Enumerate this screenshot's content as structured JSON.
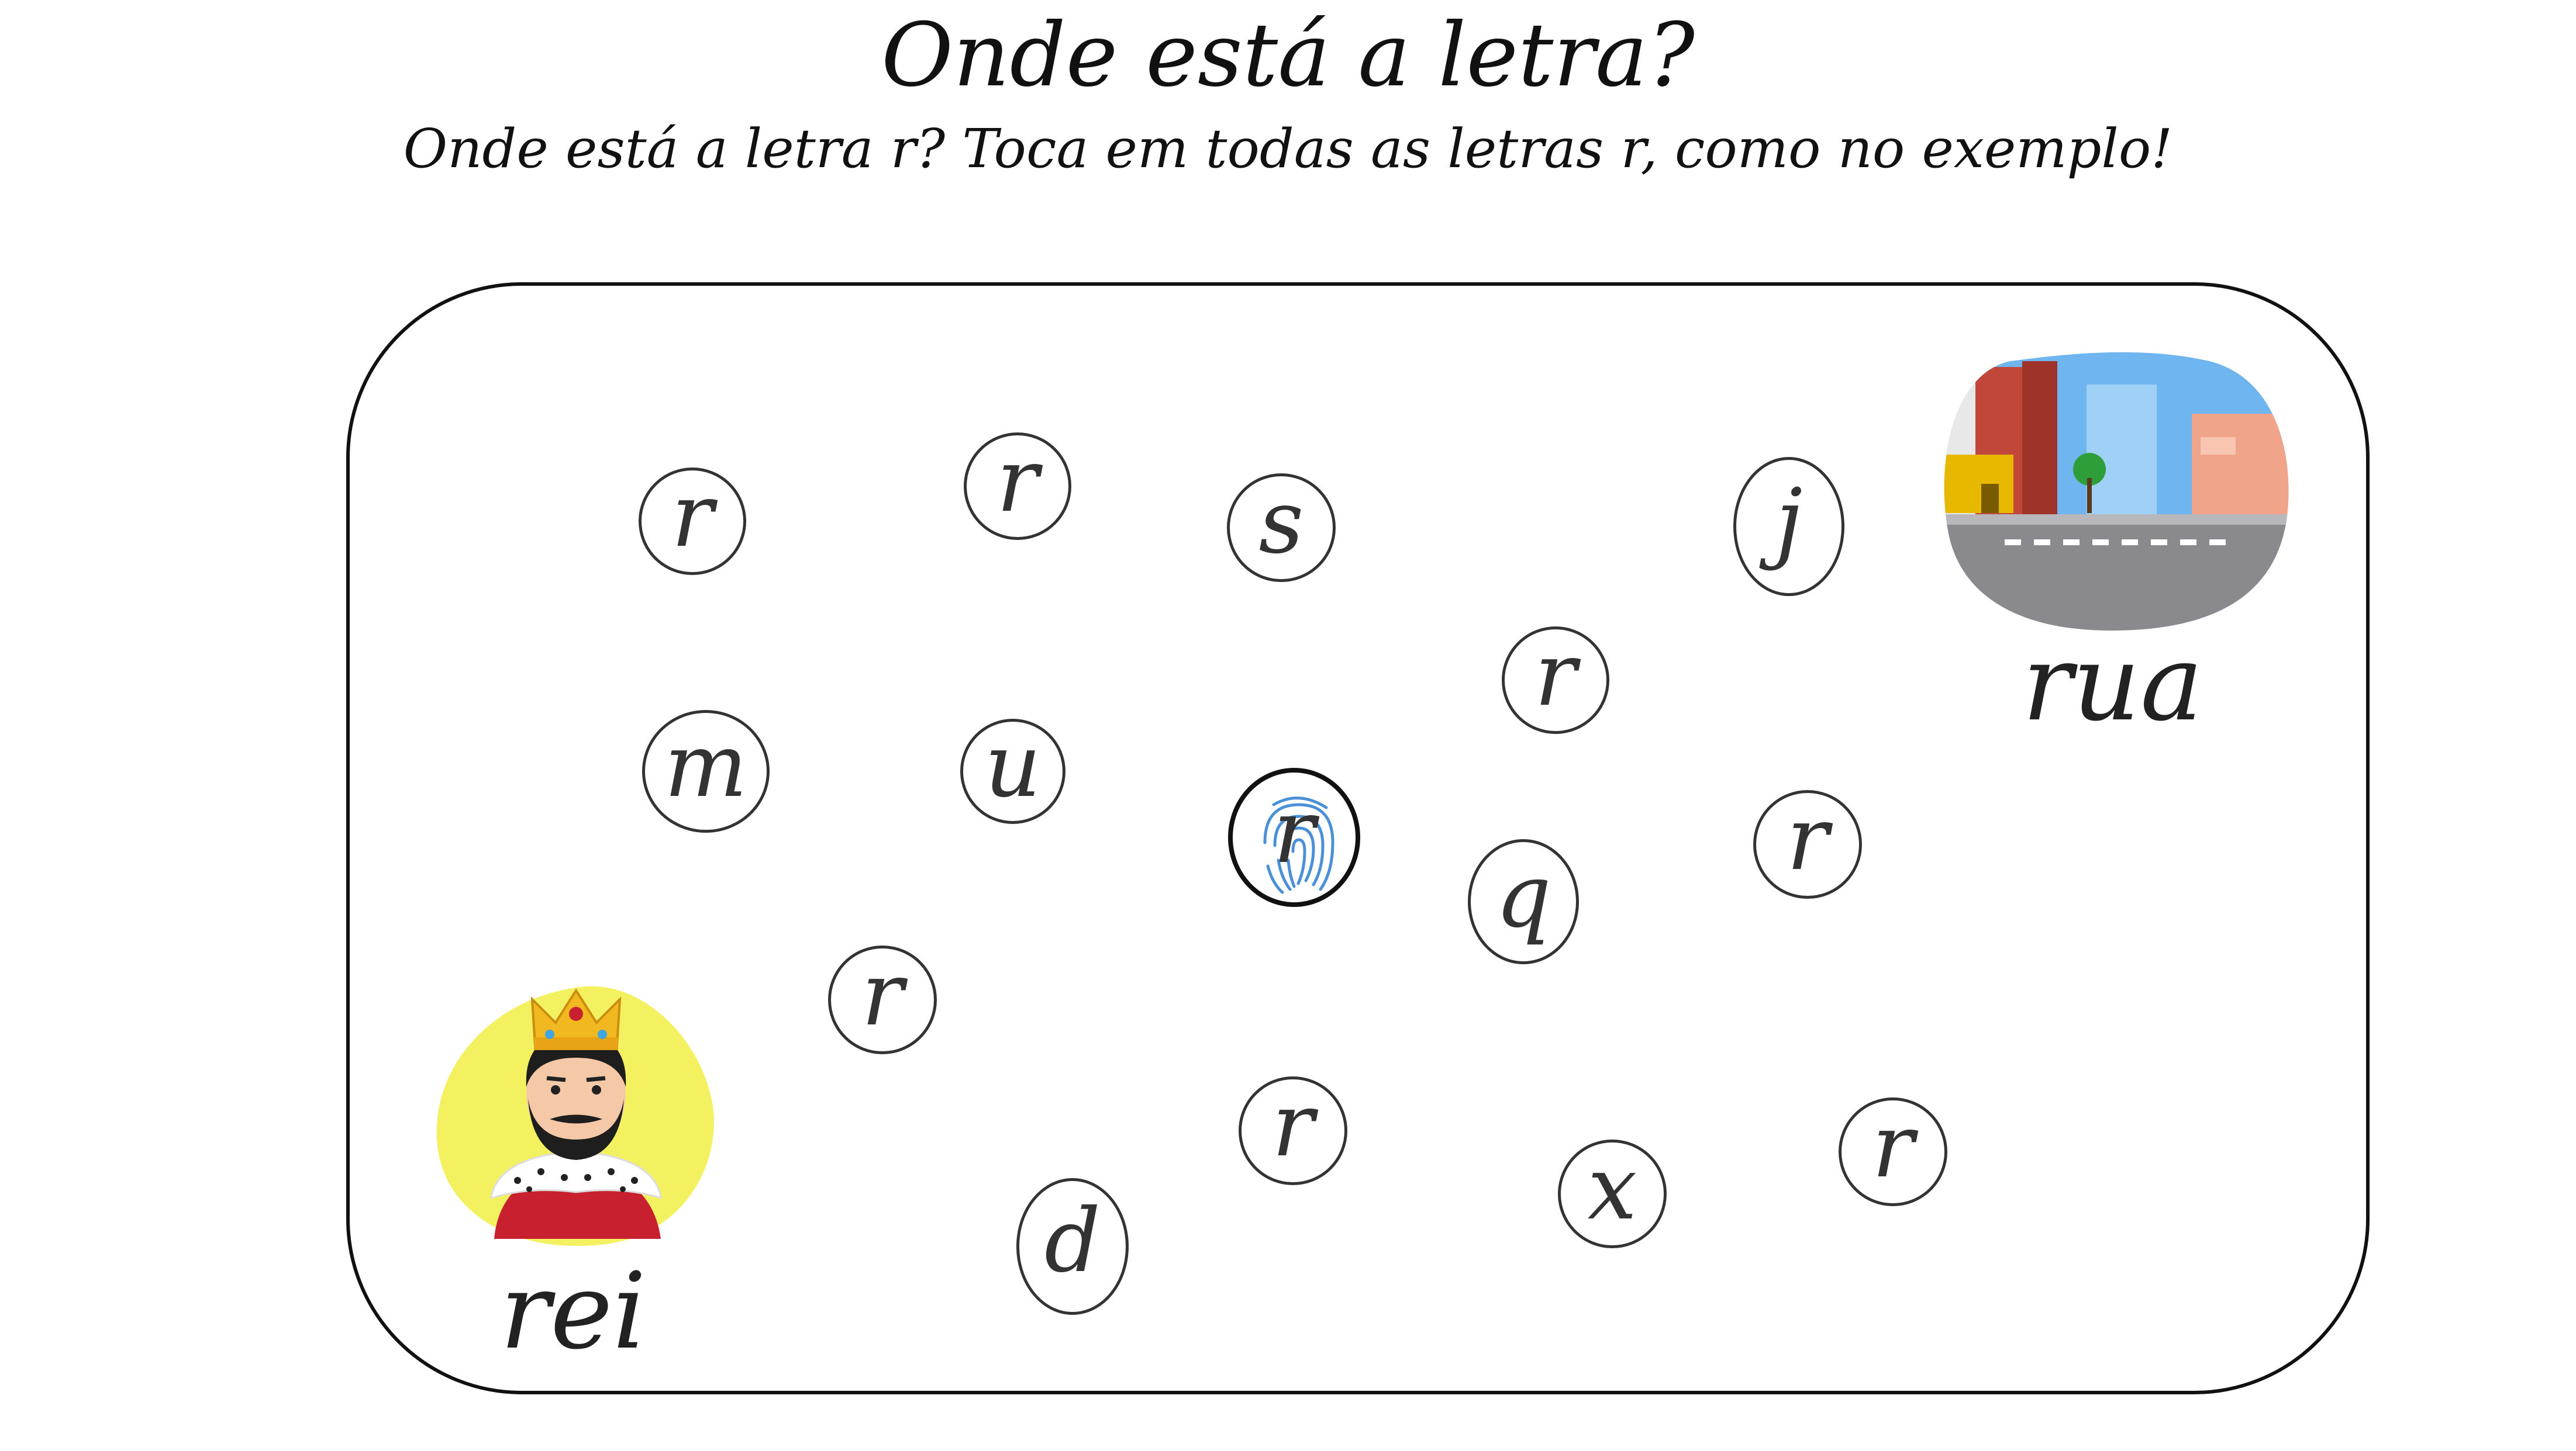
{
  "header": {
    "title": "Onde está a letra?",
    "instruction": "Onde está a letra r? Toca em todas as letras r, como no exemplo!"
  },
  "letters": [
    {
      "id": "l1",
      "char": "r"
    },
    {
      "id": "l2",
      "char": "r"
    },
    {
      "id": "l3",
      "char": "s"
    },
    {
      "id": "l4",
      "char": "j"
    },
    {
      "id": "l5",
      "char": "r"
    },
    {
      "id": "l6",
      "char": "m"
    },
    {
      "id": "l7",
      "char": "u"
    },
    {
      "id": "l8",
      "char": "r",
      "example": true
    },
    {
      "id": "l9",
      "char": "q"
    },
    {
      "id": "l10",
      "char": "r"
    },
    {
      "id": "l11",
      "char": "r"
    },
    {
      "id": "l12",
      "char": "r"
    },
    {
      "id": "l13",
      "char": "d"
    },
    {
      "id": "l14",
      "char": "x"
    },
    {
      "id": "l15",
      "char": "r"
    }
  ],
  "pictures": {
    "king": {
      "word": "rei",
      "icon": "king-icon"
    },
    "street": {
      "word": "rua",
      "icon": "street-icon"
    }
  },
  "colors": {
    "king_background": "#F4F160",
    "crown": "#F2B820",
    "cape": "#C8202E",
    "sky": "#6FB6F0",
    "road": "#8A8A8E",
    "fingerprint": "#4A90D9"
  }
}
